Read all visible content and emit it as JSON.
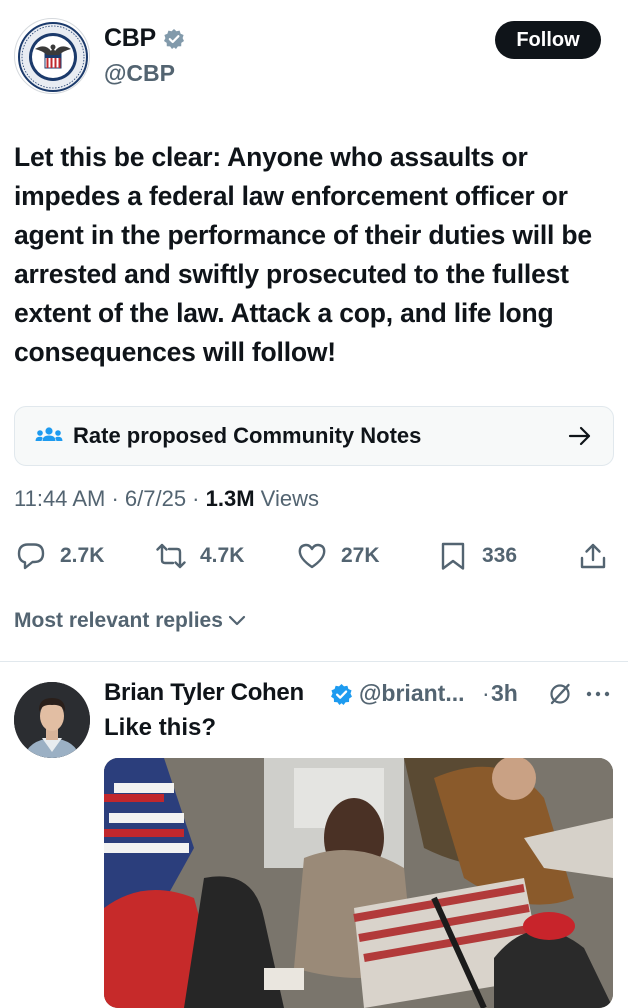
{
  "post": {
    "author_name": "CBP",
    "author_handle": "@CBP",
    "follow_label": "Follow",
    "text": "Let this be clear: Anyone who assaults or impedes a federal law enforcement officer or agent in the performance of their duties will be arrested and swiftly prosecuted to the fullest extent of the law. Attack a cop, and life long consequences will follow!",
    "community_notes_label": "Rate proposed Community Notes",
    "time": "11:44 AM",
    "date": "6/7/25",
    "views_count": "1.3M",
    "views_label": "Views",
    "replies": "2.7K",
    "reposts": "4.7K",
    "likes": "27K",
    "bookmarks": "336"
  },
  "replies_filter": "Most relevant replies",
  "reply": {
    "author_name": "Brian Tyler Cohen",
    "author_handle": "@briant...",
    "time": "3h",
    "text": "Like this?"
  },
  "colors": {
    "primary_text": "#0f1419",
    "secondary_text": "#536471",
    "verified_blue": "#1d9bf0",
    "verified_gray": "#829aab",
    "notes_icon": "#1d9bf0"
  },
  "icons": {
    "verified_org": "verified-gray-icon",
    "verified_user": "verified-blue-icon",
    "notes": "community-notes-icon",
    "arrow": "arrow-right-icon",
    "reply": "reply-icon",
    "repost": "repost-icon",
    "like": "heart-icon",
    "bookmark": "bookmark-icon",
    "share": "share-icon",
    "grok": "grok-icon",
    "more": "more-icon"
  }
}
